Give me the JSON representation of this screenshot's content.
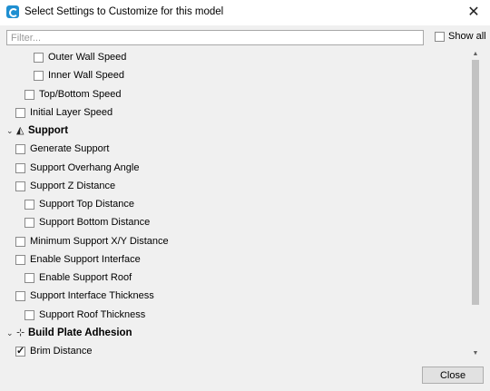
{
  "window": {
    "title": "Select Settings to Customize for this model",
    "icon": "cura-app-icon",
    "close_glyph": "✕"
  },
  "filter": {
    "value": "",
    "placeholder": "Filter..."
  },
  "show_all": {
    "label": "Show all",
    "checked": false
  },
  "settings": [
    {
      "kind": "item",
      "label": "Outer Wall Speed",
      "depth": 2,
      "checked": false
    },
    {
      "kind": "item",
      "label": "Inner Wall Speed",
      "depth": 2,
      "checked": false
    },
    {
      "kind": "item",
      "label": "Top/Bottom Speed",
      "depth": 1,
      "checked": false
    },
    {
      "kind": "item",
      "label": "Initial Layer Speed",
      "depth": 0,
      "checked": false
    },
    {
      "kind": "category",
      "label": "Support",
      "icon": "support-icon",
      "expanded": true
    },
    {
      "kind": "item",
      "label": "Generate Support",
      "depth": 0,
      "checked": false
    },
    {
      "kind": "item",
      "label": "Support Overhang Angle",
      "depth": 0,
      "checked": false
    },
    {
      "kind": "item",
      "label": "Support Z Distance",
      "depth": 0,
      "checked": false
    },
    {
      "kind": "item",
      "label": "Support Top Distance",
      "depth": 1,
      "checked": false
    },
    {
      "kind": "item",
      "label": "Support Bottom Distance",
      "depth": 1,
      "checked": false
    },
    {
      "kind": "item",
      "label": "Minimum Support X/Y Distance",
      "depth": 0,
      "checked": false
    },
    {
      "kind": "item",
      "label": "Enable Support Interface",
      "depth": 0,
      "checked": false
    },
    {
      "kind": "item",
      "label": "Enable Support Roof",
      "depth": 1,
      "checked": false
    },
    {
      "kind": "item",
      "label": "Support Interface Thickness",
      "depth": 0,
      "checked": false
    },
    {
      "kind": "item",
      "label": "Support Roof Thickness",
      "depth": 1,
      "checked": false
    },
    {
      "kind": "category",
      "label": "Build Plate Adhesion",
      "icon": "adhesion-icon",
      "expanded": true
    },
    {
      "kind": "item",
      "label": "Brim Distance",
      "depth": 0,
      "checked": true
    }
  ],
  "scrollbar": {
    "position": 0.0,
    "visible_fraction": 0.85
  },
  "buttons": {
    "close_label": "Close"
  },
  "colors": {
    "accent": "#1f8fd1",
    "background": "#f0f0f0"
  }
}
